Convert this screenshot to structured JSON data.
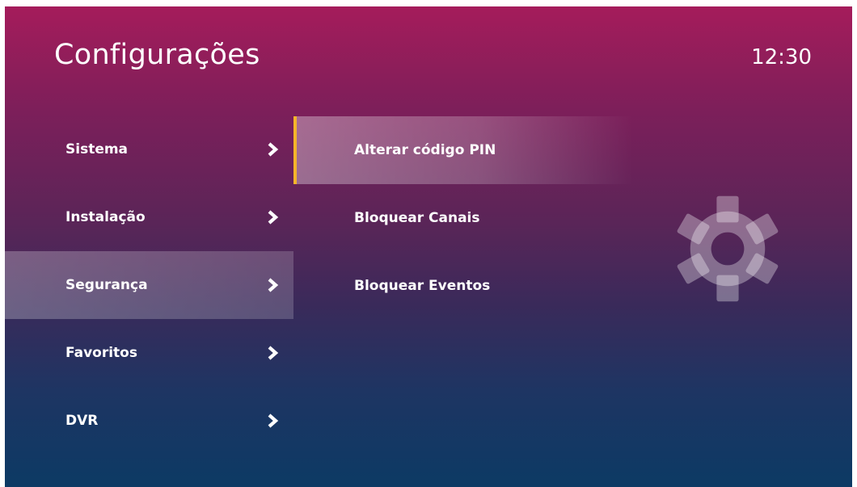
{
  "header": {
    "title": "Configurações",
    "clock": "12:30"
  },
  "left_menu": {
    "selected_index": 2,
    "items": [
      {
        "label": "Sistema"
      },
      {
        "label": "Instalação"
      },
      {
        "label": "Segurança"
      },
      {
        "label": "Favoritos"
      },
      {
        "label": "DVR"
      }
    ]
  },
  "sub_menu": {
    "focused_index": 0,
    "items": [
      {
        "label": "Alterar código PIN"
      },
      {
        "label": "Bloquear Canais"
      },
      {
        "label": "Bloquear Eventos"
      }
    ]
  },
  "icons": {
    "chevron": "chevron-right-icon",
    "section": "gear-icon"
  },
  "colors": {
    "focus_accent": "#f5b52a",
    "background_top": "#a51c5b",
    "background_bottom": "#0c3a64"
  }
}
